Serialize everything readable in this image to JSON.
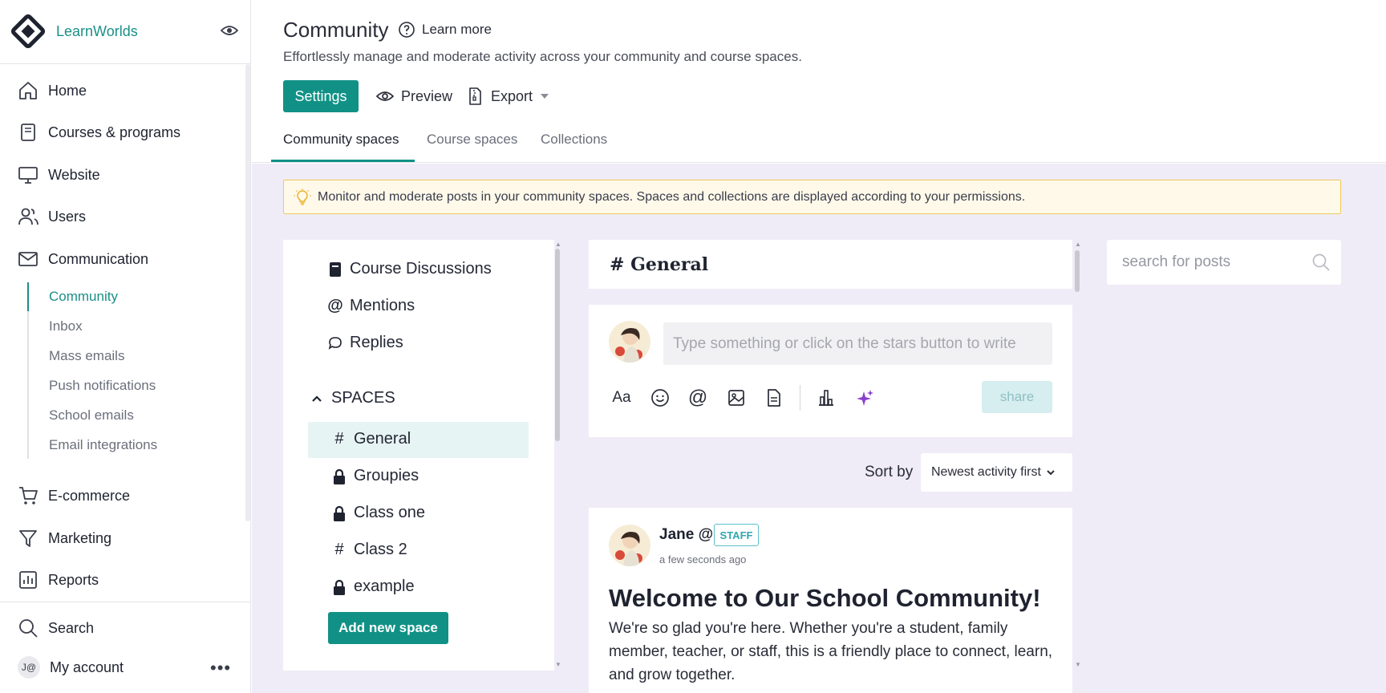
{
  "brand": {
    "name": "LearnWorlds"
  },
  "sidebar": {
    "items": [
      {
        "label": "Home",
        "icon": "home-icon"
      },
      {
        "label": "Courses & programs",
        "icon": "book-icon"
      },
      {
        "label": "Website",
        "icon": "monitor-icon"
      },
      {
        "label": "Users",
        "icon": "users-icon"
      },
      {
        "label": "Communication",
        "icon": "mail-icon"
      },
      {
        "label": "E-commerce",
        "icon": "cart-icon"
      },
      {
        "label": "Marketing",
        "icon": "funnel-icon"
      },
      {
        "label": "Reports",
        "icon": "chart-icon"
      }
    ],
    "subitems": [
      {
        "label": "Community",
        "active": true
      },
      {
        "label": "Inbox"
      },
      {
        "label": "Mass emails"
      },
      {
        "label": "Push notifications"
      },
      {
        "label": "School emails"
      },
      {
        "label": "Email integrations"
      }
    ],
    "search_label": "Search",
    "account_label": "My account",
    "account_initials": "J@"
  },
  "header": {
    "title": "Community",
    "learn_more": "Learn more",
    "subtitle": "Effortlessly manage and moderate activity across your community and course spaces.",
    "settings_label": "Settings",
    "preview_label": "Preview",
    "export_label": "Export",
    "tabs": [
      {
        "label": "Community spaces",
        "active": true
      },
      {
        "label": "Course spaces"
      },
      {
        "label": "Collections"
      }
    ]
  },
  "notice": {
    "text": "Monitor and moderate posts in your community spaces. Spaces and collections are displayed according to your permissions."
  },
  "left_panel": {
    "links": [
      {
        "label": "Course Discussions",
        "icon": "book-icon"
      },
      {
        "label": "Mentions",
        "icon": "at-icon"
      },
      {
        "label": "Replies",
        "icon": "comment-icon"
      }
    ],
    "spaces_heading": "SPACES",
    "spaces": [
      {
        "label": "General",
        "icon": "hash-icon",
        "active": true
      },
      {
        "label": "Groupies",
        "icon": "lock-icon"
      },
      {
        "label": "Class one",
        "icon": "lock-icon"
      },
      {
        "label": "Class 2",
        "icon": "hash-icon"
      },
      {
        "label": "example",
        "icon": "lock-icon"
      }
    ],
    "add_space_label": "Add new space"
  },
  "feed": {
    "space_title": "# General",
    "composer_placeholder": "Type something or click on the stars button to write",
    "share_label": "share",
    "sort_label": "Sort by",
    "sort_value": "Newest activity first",
    "post": {
      "author": "Jane @",
      "badge": "STAFF",
      "time": "a few seconds ago",
      "title": "Welcome to Our School Community!",
      "body": "We're so glad you're here. Whether you're a student, family member, teacher, or staff, this is a friendly place to connect, learn, and grow together."
    }
  },
  "search": {
    "placeholder": "search for posts"
  },
  "colors": {
    "accent": "#119186",
    "brand_text": "#1a8f86",
    "page_bg": "#efecf7",
    "notice_bg": "#fff9ea",
    "notice_border": "#f0c95c"
  }
}
